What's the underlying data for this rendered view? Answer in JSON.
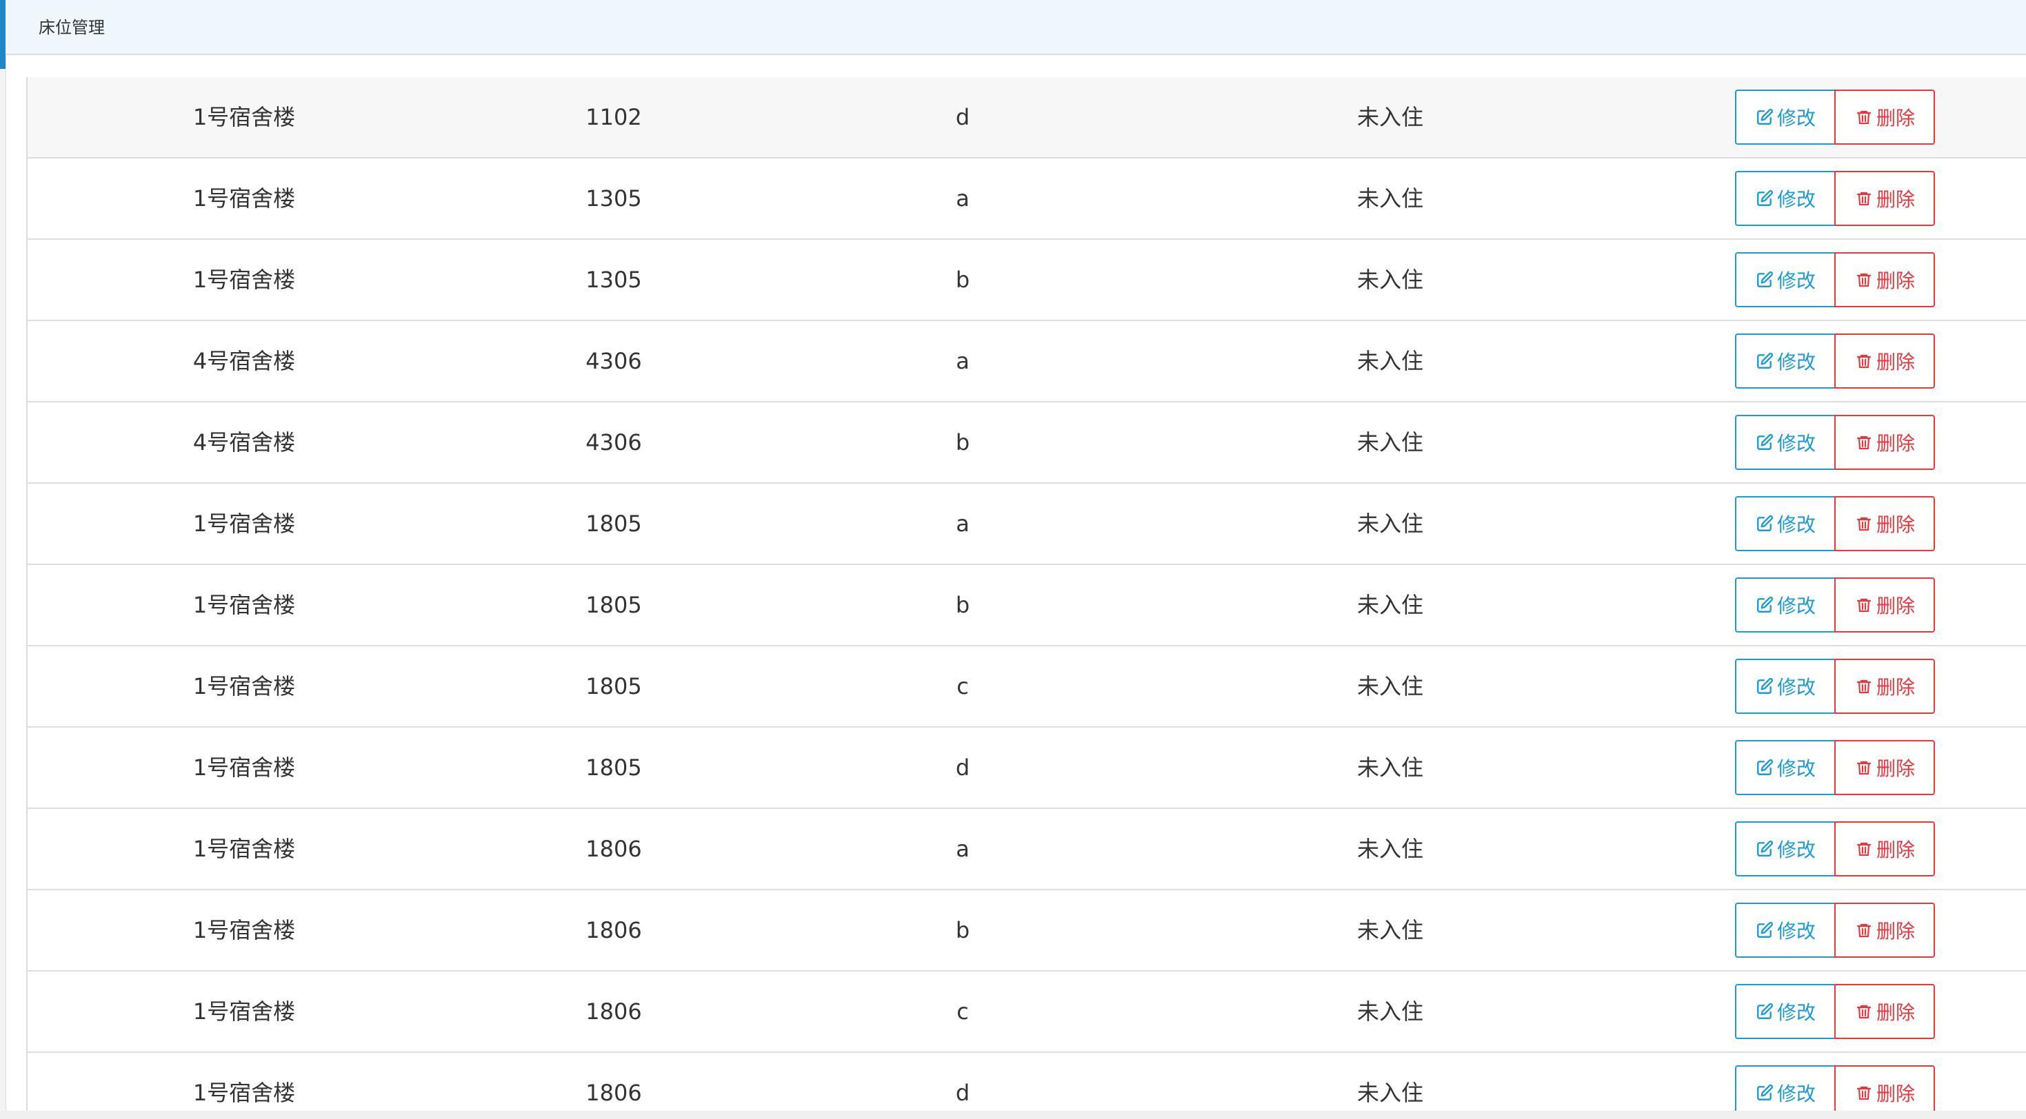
{
  "tab": {
    "title": "床位管理"
  },
  "icons": {
    "edit": "edit-icon",
    "delete": "trash-icon"
  },
  "colors": {
    "edit": "#1a9bd6",
    "delete": "#e8373d",
    "header_bg": "#eef7fc",
    "accent": "#1f86c8"
  },
  "actions": {
    "edit_label": "修改",
    "delete_label": "删除"
  },
  "rows": [
    {
      "building": "1号宿舍楼",
      "room": "1102",
      "bed": "d",
      "status": "未入住"
    },
    {
      "building": "1号宿舍楼",
      "room": "1305",
      "bed": "a",
      "status": "未入住"
    },
    {
      "building": "1号宿舍楼",
      "room": "1305",
      "bed": "b",
      "status": "未入住"
    },
    {
      "building": "4号宿舍楼",
      "room": "4306",
      "bed": "a",
      "status": "未入住"
    },
    {
      "building": "4号宿舍楼",
      "room": "4306",
      "bed": "b",
      "status": "未入住"
    },
    {
      "building": "1号宿舍楼",
      "room": "1805",
      "bed": "a",
      "status": "未入住"
    },
    {
      "building": "1号宿舍楼",
      "room": "1805",
      "bed": "b",
      "status": "未入住"
    },
    {
      "building": "1号宿舍楼",
      "room": "1805",
      "bed": "c",
      "status": "未入住"
    },
    {
      "building": "1号宿舍楼",
      "room": "1805",
      "bed": "d",
      "status": "未入住"
    },
    {
      "building": "1号宿舍楼",
      "room": "1806",
      "bed": "a",
      "status": "未入住"
    },
    {
      "building": "1号宿舍楼",
      "room": "1806",
      "bed": "b",
      "status": "未入住"
    },
    {
      "building": "1号宿舍楼",
      "room": "1806",
      "bed": "c",
      "status": "未入住"
    },
    {
      "building": "1号宿舍楼",
      "room": "1806",
      "bed": "d",
      "status": "未入住"
    }
  ]
}
